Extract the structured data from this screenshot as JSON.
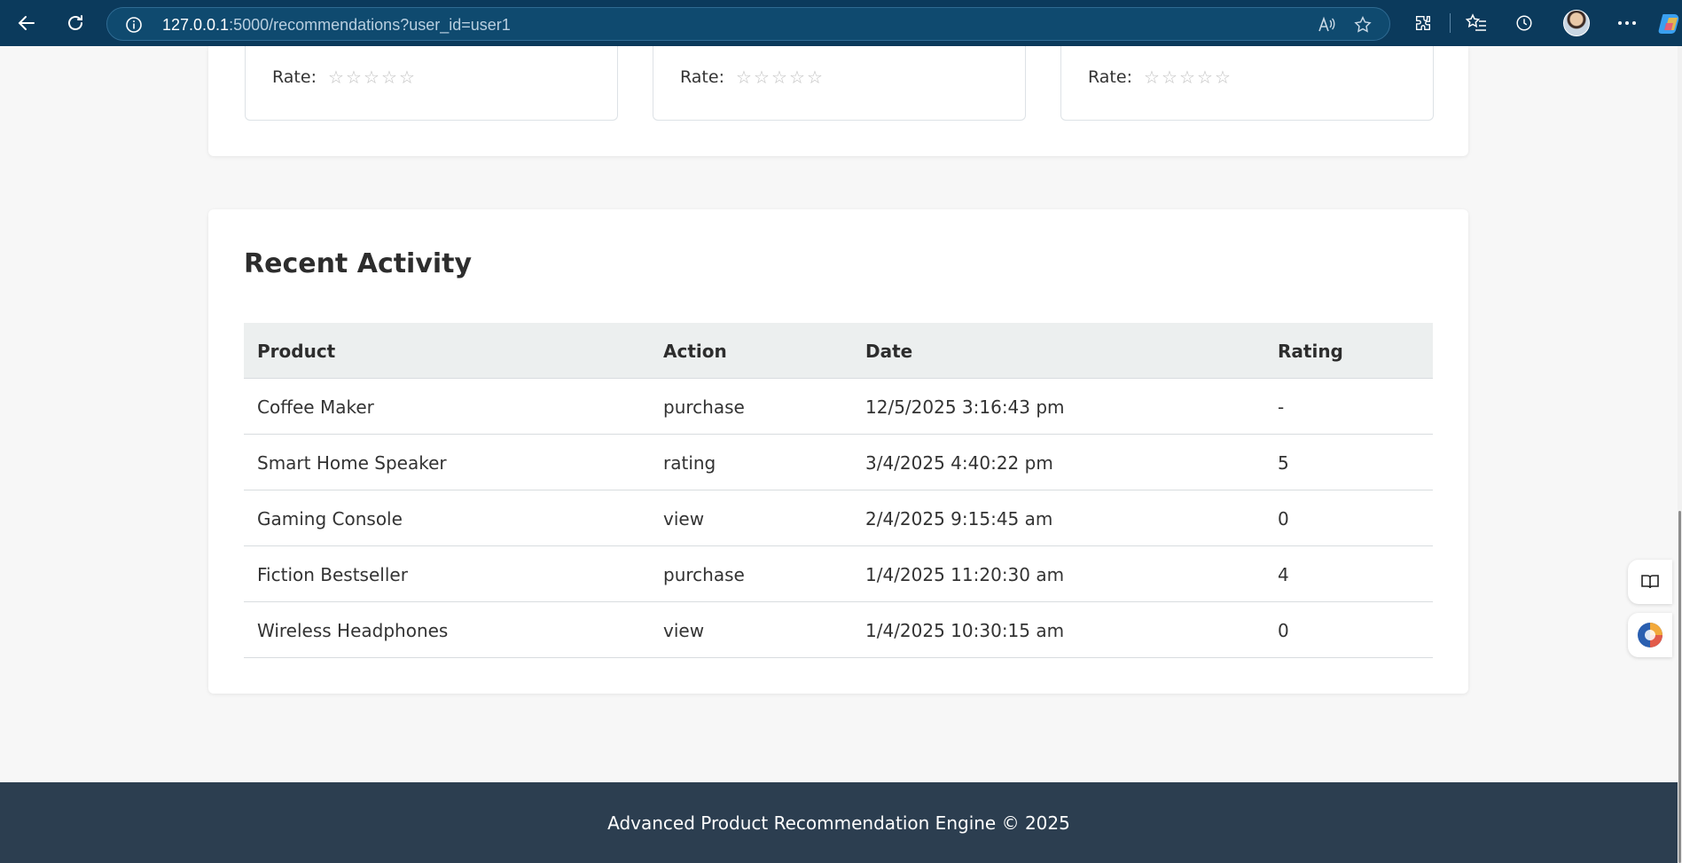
{
  "browser": {
    "url_host": "127.0.0.1",
    "url_path": ":5000/recommendations?user_id=user1",
    "icons": [
      "back-arrow-icon",
      "refresh-icon",
      "info-icon",
      "read-aloud-icon",
      "favorite-star-icon",
      "extensions-icon",
      "favorites-list-icon",
      "history-icon",
      "profile-avatar",
      "more-options-icon",
      "copilot-icon"
    ]
  },
  "recommendations": {
    "cards": [
      {
        "rate_label": "Rate:",
        "stars": 5
      },
      {
        "rate_label": "Rate:",
        "stars": 5
      },
      {
        "rate_label": "Rate:",
        "stars": 5
      }
    ]
  },
  "activity": {
    "title": "Recent Activity",
    "headers": [
      "Product",
      "Action",
      "Date",
      "Rating"
    ],
    "rows": [
      [
        "Coffee Maker",
        "purchase",
        "12/5/2025 3:16:43 pm",
        "-"
      ],
      [
        "Smart Home Speaker",
        "rating",
        "3/4/2025 4:40:22 pm",
        "5"
      ],
      [
        "Gaming Console",
        "view",
        "2/4/2025 9:15:45 am",
        "0"
      ],
      [
        "Fiction Bestseller",
        "purchase",
        "1/4/2025 11:20:30 am",
        "4"
      ],
      [
        "Wireless Headphones",
        "view",
        "1/4/2025 10:30:15 am",
        "0"
      ]
    ]
  },
  "footer": {
    "text": "Advanced Product Recommendation Engine © 2025"
  },
  "colors": {
    "browser_bar": "#0b3a5c",
    "footer": "#2c3e50",
    "table_header": "#ecefef",
    "page_background": "#f7f7f7"
  }
}
